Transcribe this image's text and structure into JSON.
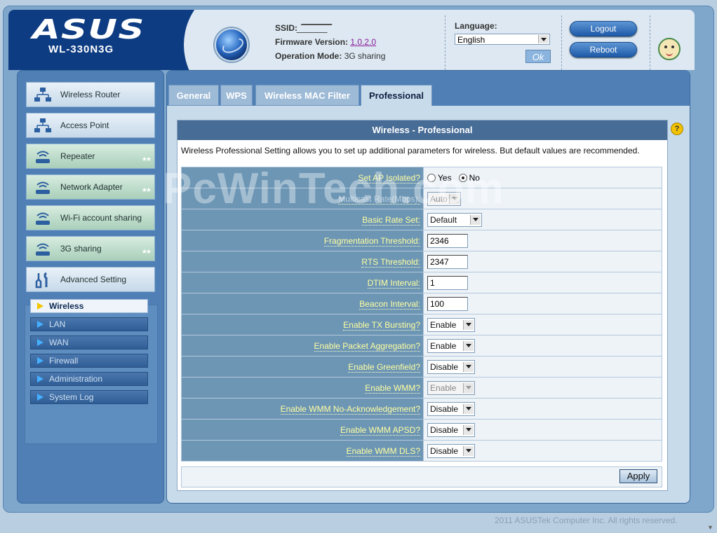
{
  "header": {
    "brand": "ASUS",
    "model": "WL-330N3G",
    "ssid_label": "SSID:",
    "firmware_label": "Firmware Version:",
    "firmware_value": "1.0.2.0",
    "opmode_label": "Operation Mode:",
    "opmode_value": "3G sharing",
    "language_label": "Language:",
    "language_value": "English",
    "ok_label": "Ok",
    "logout_label": "Logout",
    "reboot_label": "Reboot"
  },
  "sidebar": {
    "items": [
      {
        "label": "Wireless Router",
        "icon": "network-icon"
      },
      {
        "label": "Access Point",
        "icon": "network-icon"
      },
      {
        "label": "Repeater",
        "icon": "wifi-device-icon"
      },
      {
        "label": "Network Adapter",
        "icon": "wifi-device-icon"
      },
      {
        "label": "Wi-Fi account sharing",
        "icon": "wifi-device-icon"
      },
      {
        "label": "3G sharing",
        "icon": "wifi-device-icon"
      },
      {
        "label": "Advanced Setting",
        "icon": "tools-icon"
      }
    ],
    "stars": "★★",
    "submenu": [
      "Wireless",
      "LAN",
      "WAN",
      "Firewall",
      "Administration",
      "System Log"
    ]
  },
  "tabs": [
    "General",
    "WPS",
    "Wireless MAC Filter",
    "Professional"
  ],
  "panel": {
    "title": "Wireless - Professional",
    "description": "Wireless Professional Setting allows you to set up additional parameters for wireless. But default values are recommended.",
    "fields": {
      "ap_isolated": {
        "label": "Set AP Isolated?",
        "yes": "Yes",
        "no": "No"
      },
      "multicast_rate": {
        "label": "Multicast Rate(Mbps):",
        "value": "Auto"
      },
      "basic_rate_set": {
        "label": "Basic Rate Set:",
        "value": "Default"
      },
      "frag_threshold": {
        "label": "Fragmentation Threshold:",
        "value": "2346"
      },
      "rts_threshold": {
        "label": "RTS Threshold:",
        "value": "2347"
      },
      "dtim_interval": {
        "label": "DTIM Interval:",
        "value": "1"
      },
      "beacon_interval": {
        "label": "Beacon Interval:",
        "value": "100"
      },
      "tx_bursting": {
        "label": "Enable TX Bursting?",
        "value": "Enable"
      },
      "packet_aggregation": {
        "label": "Enable Packet Aggregation?",
        "value": "Enable"
      },
      "greenfield": {
        "label": "Enable Greenfield?",
        "value": "Disable"
      },
      "wmm": {
        "label": "Enable WMM?",
        "value": "Enable"
      },
      "wmm_noack": {
        "label": "Enable WMM No-Acknowledgement?",
        "value": "Disable"
      },
      "wmm_apsd": {
        "label": "Enable WMM APSD?",
        "value": "Disable"
      },
      "wmm_dls": {
        "label": "Enable WMM DLS?",
        "value": "Disable"
      }
    },
    "apply_label": "Apply"
  },
  "watermark": "PcWinTech.com",
  "footer": "2011 ASUSTek Computer Inc. All rights reserved.",
  "colors": {
    "brand_blue": "#0e3c82",
    "label_yellow": "#ffffa0",
    "panel_title": "#476c96"
  }
}
